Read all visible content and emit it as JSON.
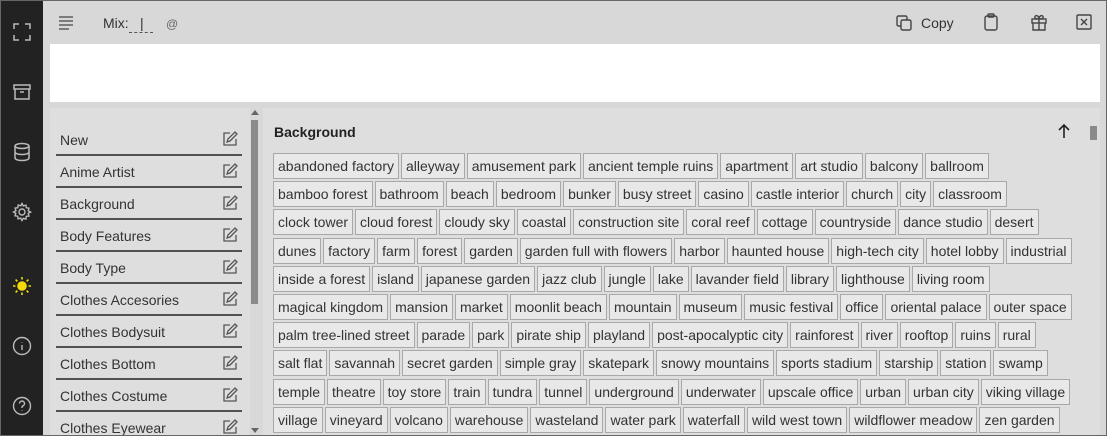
{
  "rail": {
    "items": [
      {
        "name": "fullscreen-icon"
      },
      {
        "name": "archive-icon"
      },
      {
        "name": "database-icon"
      },
      {
        "name": "gear-icon"
      },
      {
        "name": "sun-icon",
        "color": "#f5d90a"
      },
      {
        "name": "info-icon"
      },
      {
        "name": "help-icon"
      }
    ]
  },
  "toolbar": {
    "mix_label": "Mix:",
    "mix_value": "|",
    "mix_at": "@",
    "copy_label": "Copy"
  },
  "prompt": {
    "value": ""
  },
  "categories": {
    "items": [
      {
        "label": "New"
      },
      {
        "label": "Anime Artist"
      },
      {
        "label": "Background"
      },
      {
        "label": "Body Features"
      },
      {
        "label": "Body Type"
      },
      {
        "label": "Clothes Accesories"
      },
      {
        "label": "Clothes Bodysuit"
      },
      {
        "label": "Clothes Bottom"
      },
      {
        "label": "Clothes Costume"
      },
      {
        "label": "Clothes Eyewear"
      }
    ]
  },
  "tag_panel": {
    "title": "Background",
    "rows": [
      [
        "abandoned factory",
        "alleyway",
        "amusement park",
        "ancient temple ruins",
        "apartment",
        "art studio",
        "balcony",
        "ballroom"
      ],
      [
        "bamboo forest",
        "bathroom",
        "beach",
        "bedroom",
        "bunker",
        "busy street",
        "casino",
        "castle interior",
        "church",
        "city",
        "classroom"
      ],
      [
        "clock tower",
        "cloud forest",
        "cloudy sky",
        "coastal",
        "construction site",
        "coral reef",
        "cottage",
        "countryside",
        "dance studio",
        "desert"
      ],
      [
        "dunes",
        "factory",
        "farm",
        "forest",
        "garden",
        "garden full with flowers",
        "harbor",
        "haunted house",
        "high-tech city",
        "hotel lobby",
        "industrial"
      ],
      [
        "inside a forest",
        "island",
        "japanese garden",
        "jazz club",
        "jungle",
        "lake",
        "lavander field",
        "library",
        "lighthouse",
        "living room"
      ],
      [
        "magical kingdom",
        "mansion",
        "market",
        "moonlit beach",
        "mountain",
        "museum",
        "music festival",
        "office",
        "oriental palace",
        "outer space"
      ],
      [
        "palm tree-lined street",
        "parade",
        "park",
        "pirate ship",
        "playland",
        "post-apocalyptic city",
        "rainforest",
        "river",
        "rooftop",
        "ruins",
        "rural"
      ],
      [
        "salt flat",
        "savannah",
        "secret garden",
        "simple gray",
        "skatepark",
        "snowy mountains",
        "sports stadium",
        "starship",
        "station",
        "swamp"
      ],
      [
        "temple",
        "theatre",
        "toy store",
        "train",
        "tundra",
        "tunnel",
        "underground",
        "underwater",
        "upscale office",
        "urban",
        "urban city",
        "viking village"
      ],
      [
        "village",
        "vineyard",
        "volcano",
        "warehouse",
        "wasteland",
        "water park",
        "waterfall",
        "wild west town",
        "wildflower meadow",
        "zen garden"
      ]
    ]
  }
}
